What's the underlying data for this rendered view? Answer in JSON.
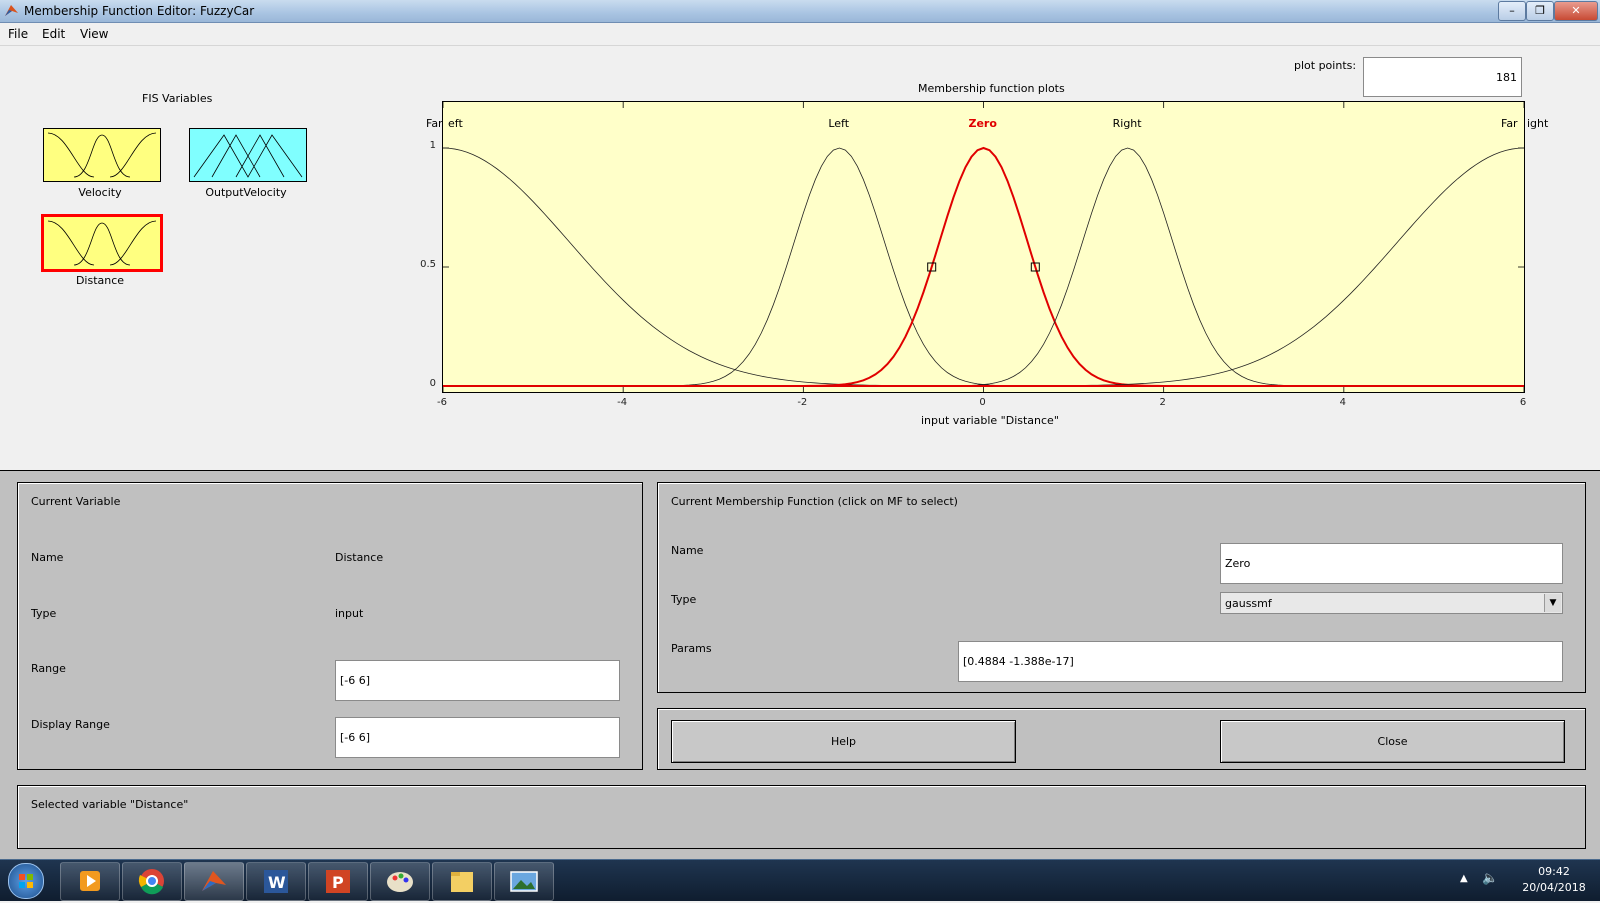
{
  "window": {
    "title": "Membership Function Editor: FuzzyCar",
    "min": "–",
    "max": "❐",
    "close": "✕"
  },
  "menu": [
    "File",
    "Edit",
    "View"
  ],
  "fis": {
    "heading": "FIS Variables",
    "vars": [
      {
        "label": "Velocity"
      },
      {
        "label": "OutputVelocity"
      },
      {
        "label": "Distance"
      }
    ]
  },
  "plot_points": {
    "label": "plot points:",
    "value": "181"
  },
  "chart_data": {
    "type": "line",
    "title": "Membership function plots",
    "xlabel": "input variable \"Distance\"",
    "xlim": [
      -6,
      6
    ],
    "ylim": [
      0,
      1
    ],
    "xticks": [
      "-6",
      "-4",
      "-2",
      "0",
      "2",
      "4",
      "6"
    ],
    "yticks": [
      "0",
      "0.5",
      "1"
    ],
    "selected_index": 2,
    "series": [
      {
        "name": "FarLeft",
        "mf": "gaussmf",
        "sigma": 1.4,
        "center": -6
      },
      {
        "name": "Left",
        "mf": "gaussmf",
        "sigma": 0.5,
        "center": -1.6
      },
      {
        "name": "Zero",
        "mf": "gaussmf",
        "sigma": 0.4884,
        "center": 0
      },
      {
        "name": "Right",
        "mf": "gaussmf",
        "sigma": 0.5,
        "center": 1.6
      },
      {
        "name": "FarRight",
        "mf": "gaussmf",
        "sigma": 1.4,
        "center": 6
      }
    ],
    "labels": [
      "Far",
      "eft",
      "Left",
      "Zero",
      "Right",
      "Far",
      "ight"
    ],
    "colors": {
      "normal": "#222222",
      "selected": "#e00000",
      "background": "#ffffc9"
    }
  },
  "current_variable": {
    "heading": "Current Variable",
    "name_label": "Name",
    "name_value": "Distance",
    "type_label": "Type",
    "type_value": "input",
    "range_label": "Range",
    "range_value": "[-6 6]",
    "display_range_label": "Display Range",
    "display_range_value": "[-6 6]"
  },
  "current_mf": {
    "heading": "Current Membership Function (click on MF to select)",
    "name_label": "Name",
    "name_value": "Zero",
    "type_label": "Type",
    "type_value": "gaussmf",
    "params_label": "Params",
    "params_value": "[0.4884 -1.388e-17]"
  },
  "buttons": {
    "help": "Help",
    "close": "Close"
  },
  "status": "Selected variable \"Distance\"",
  "taskbar": {
    "time": "09:42",
    "date": "20/04/2018"
  }
}
